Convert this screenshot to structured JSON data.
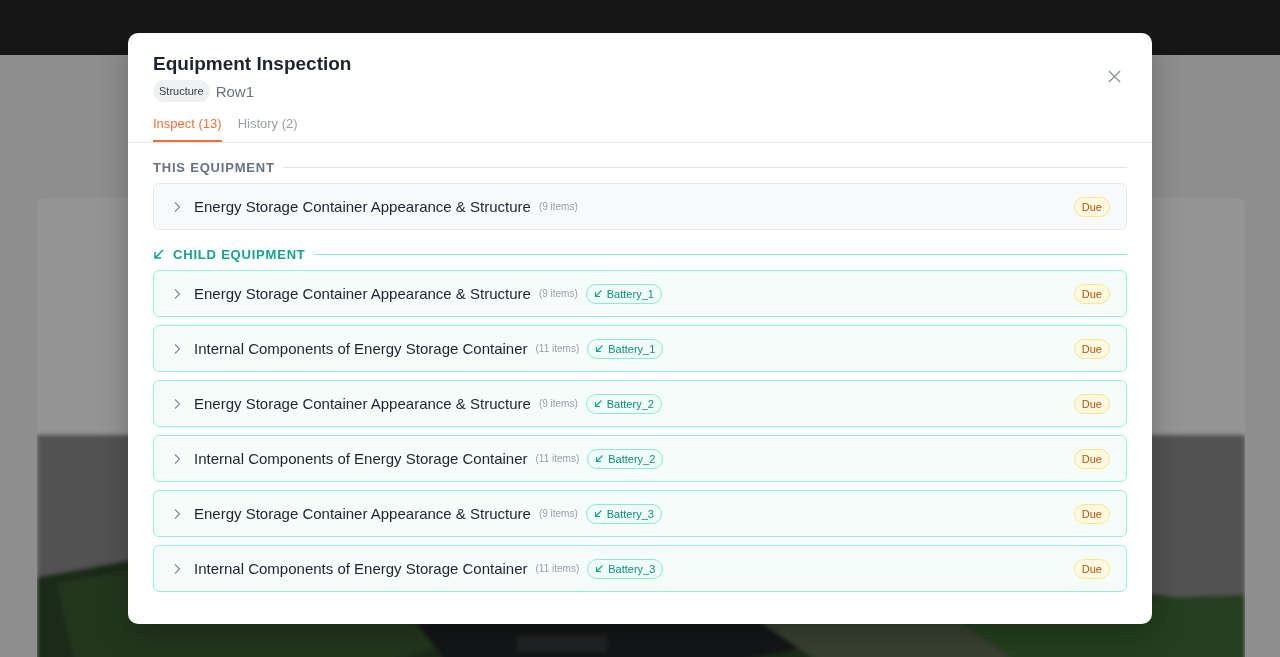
{
  "dialog": {
    "title": "Equipment Inspection",
    "type_chip": "Structure",
    "equipment_name": "Row1"
  },
  "tabs": [
    {
      "label": "Inspect (13)",
      "selected": true
    },
    {
      "label": "History (2)",
      "selected": false
    }
  ],
  "sections": [
    {
      "kind": "own",
      "heading": "THIS EQUIPMENT",
      "rows": [
        {
          "title": "Energy Storage Container Appearance & Structure",
          "count": "(9 items)",
          "status": "Due"
        }
      ]
    },
    {
      "kind": "child",
      "heading": "CHILD EQUIPMENT",
      "rows": [
        {
          "title": "Energy Storage Container Appearance & Structure",
          "count": "(9 items)",
          "child": "Battery_1",
          "status": "Due"
        },
        {
          "title": "Internal Components of Energy Storage Container",
          "count": "(11 items)",
          "child": "Battery_1",
          "status": "Due"
        },
        {
          "title": "Energy Storage Container Appearance & Structure",
          "count": "(9 items)",
          "child": "Battery_2",
          "status": "Due"
        },
        {
          "title": "Internal Components of Energy Storage Container",
          "count": "(11 items)",
          "child": "Battery_2",
          "status": "Due"
        },
        {
          "title": "Energy Storage Container Appearance & Structure",
          "count": "(9 items)",
          "child": "Battery_3",
          "status": "Due"
        },
        {
          "title": "Internal Components of Energy Storage Container",
          "count": "(11 items)",
          "child": "Battery_3",
          "status": "Due"
        }
      ]
    }
  ]
}
